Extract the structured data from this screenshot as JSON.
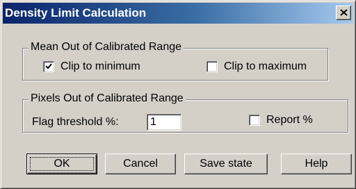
{
  "window": {
    "title": "Density Limit Calculation",
    "close_icon": "close-x-icon"
  },
  "mean_group": {
    "label": "Mean Out of Calibrated Range",
    "clip_min": {
      "label": "Clip to minimum",
      "checked": true
    },
    "clip_max": {
      "label": "Clip to maximum",
      "checked": false
    }
  },
  "pixels_group": {
    "label": "Pixels Out of Calibrated Range",
    "threshold_label": "Flag threshold %:",
    "threshold_value": "1",
    "report": {
      "label": "Report %",
      "checked": false
    }
  },
  "buttons": {
    "ok": "OK",
    "cancel": "Cancel",
    "save_state": "Save state",
    "help": "Help"
  }
}
